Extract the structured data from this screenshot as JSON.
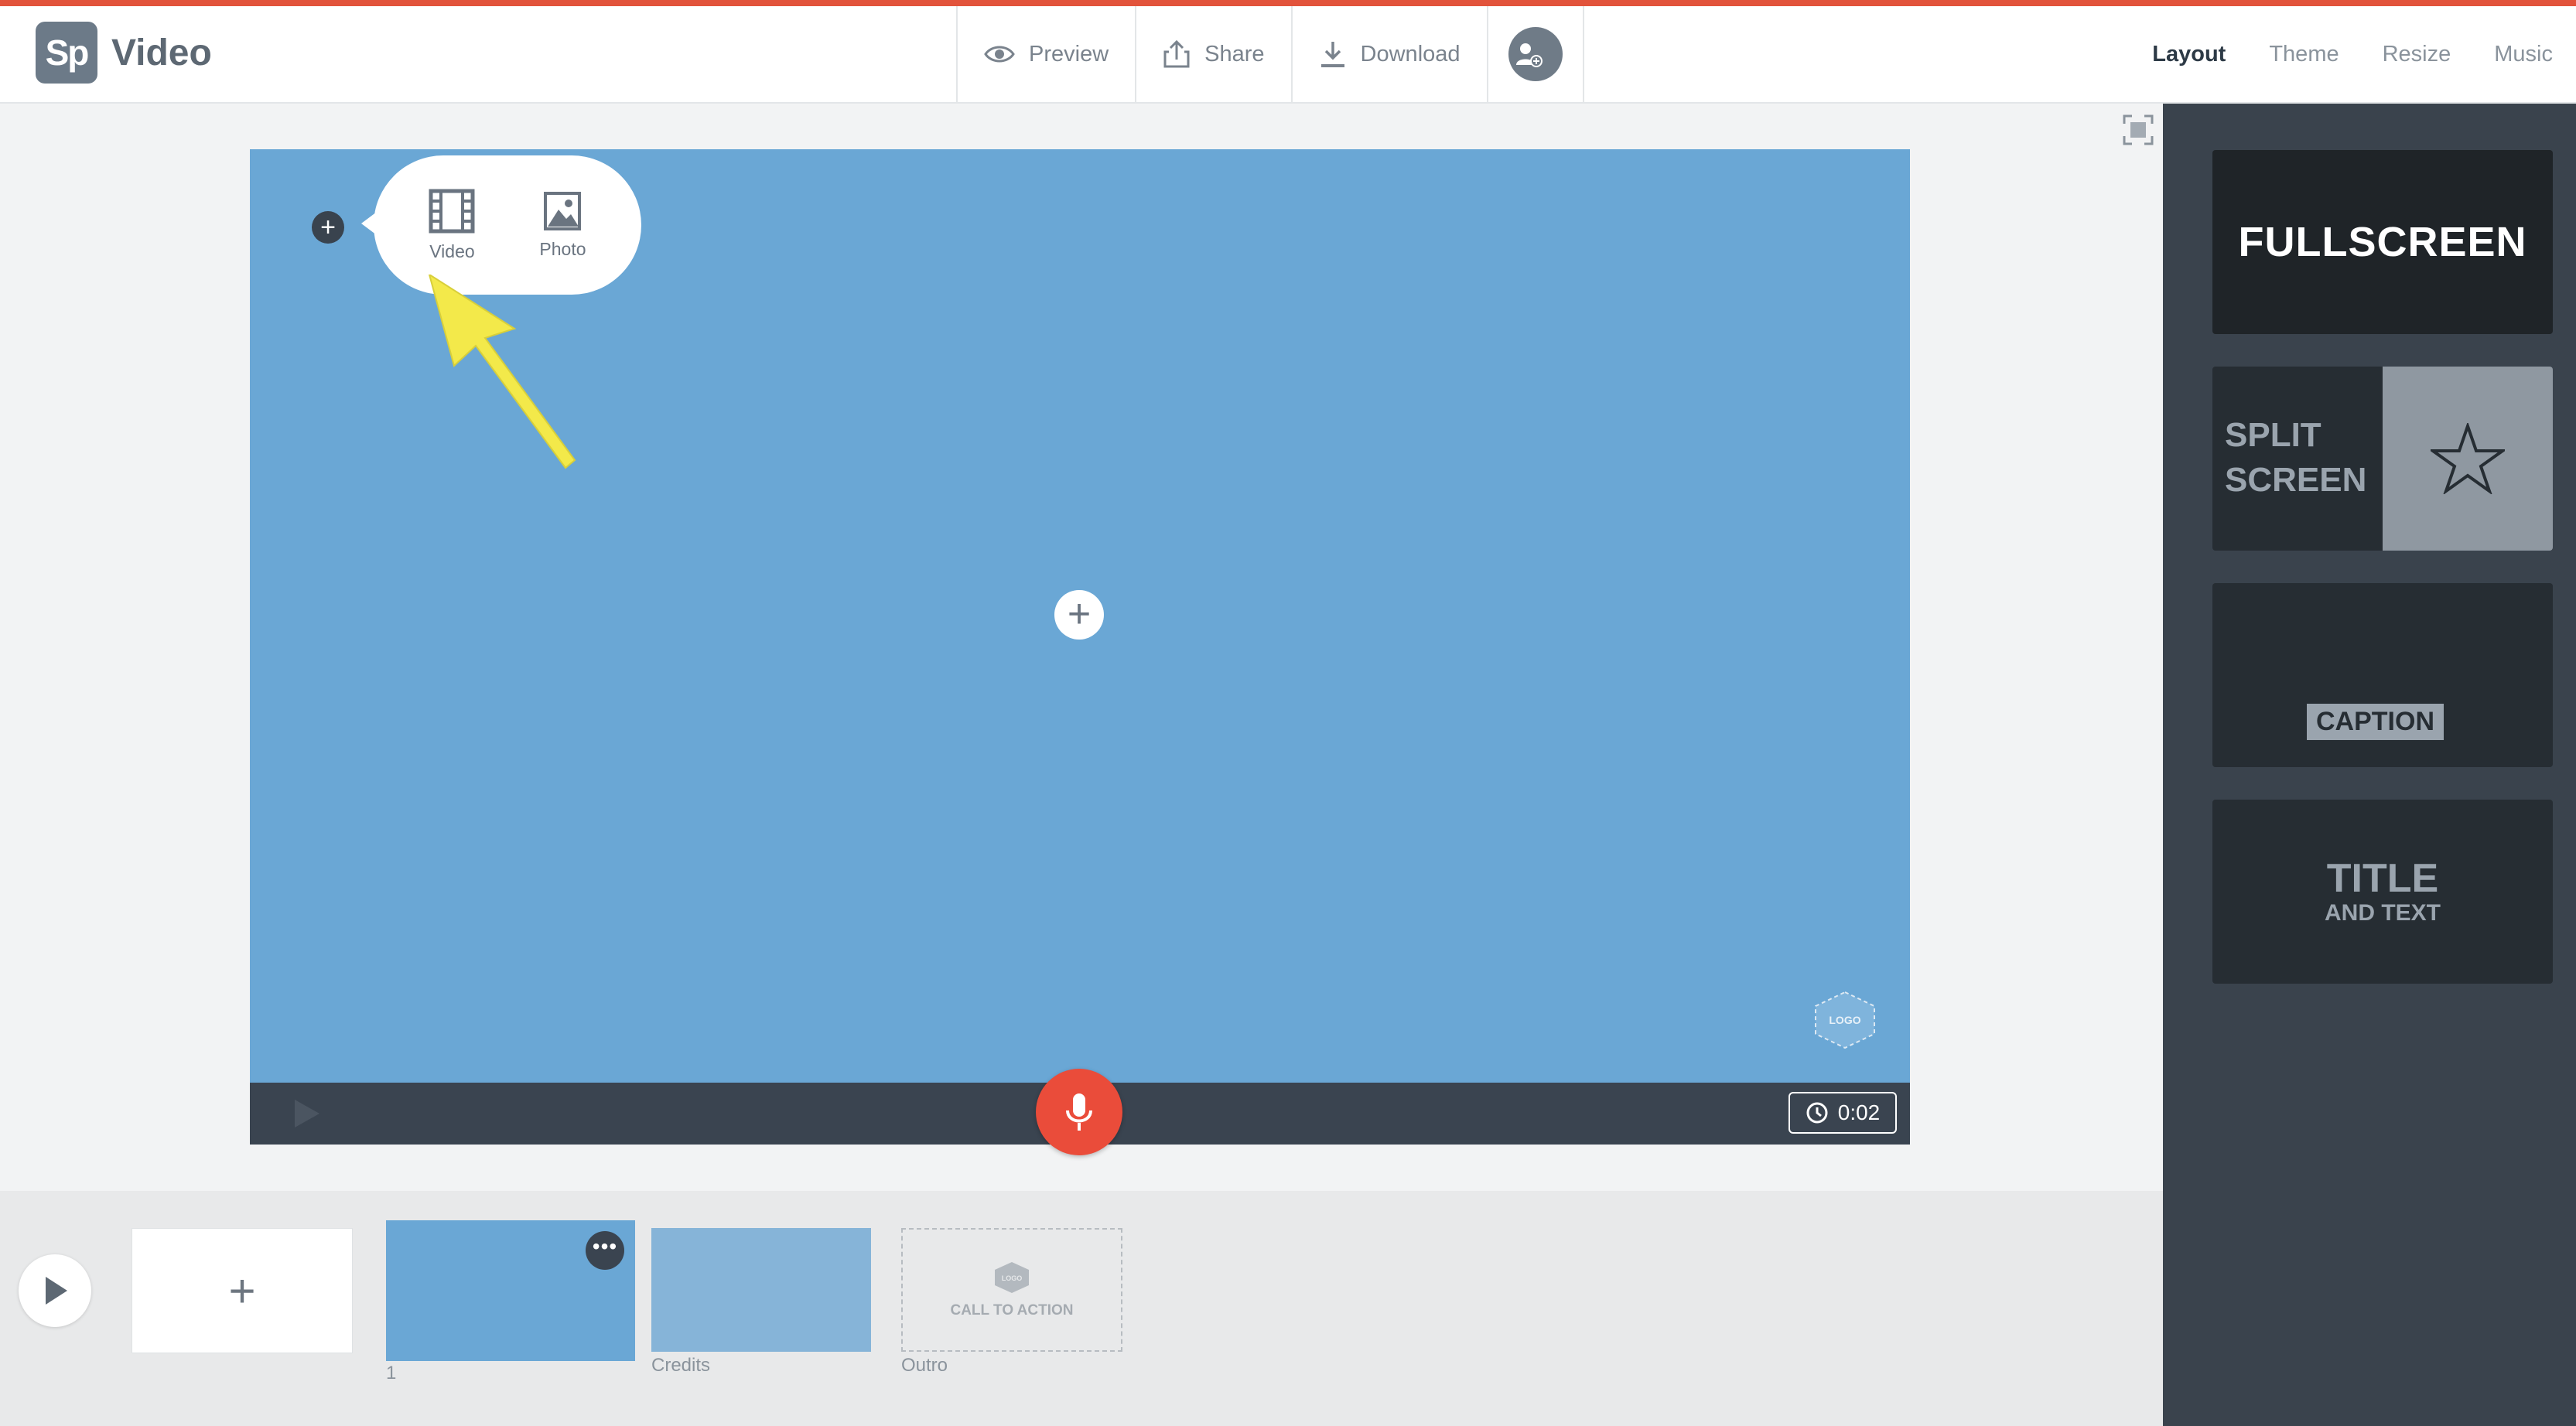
{
  "app": {
    "logo": "Sp",
    "name": "Video"
  },
  "toolbar": {
    "preview": "Preview",
    "share": "Share",
    "download": "Download"
  },
  "right_tabs": [
    "Layout",
    "Theme",
    "Resize",
    "Music"
  ],
  "right_tabs_active": "Layout",
  "canvas": {
    "popup": {
      "video": "Video",
      "photo": "Photo"
    },
    "logo_mark": "LOGO",
    "timer": "0:02"
  },
  "timeline": {
    "slides": [
      {
        "label": "1"
      },
      {
        "label": "Credits"
      },
      {
        "label": "Outro"
      }
    ],
    "add_label": "+",
    "outro_logo": "LOGO",
    "outro_cta": "CALL TO ACTION"
  },
  "layouts": {
    "fullscreen": "FULLSCREEN",
    "split_line1": "SPLIT",
    "split_line2": "SCREEN",
    "caption": "CAPTION",
    "title_line1": "TITLE",
    "title_line2": "AND TEXT"
  },
  "colors": {
    "accent": "#e2533b",
    "canvas_blue": "#6aa7d5",
    "mic_red": "#ea4c3a",
    "panel_dark": "#3a434d",
    "annotation_yellow": "#f3e94a"
  },
  "icons": [
    "eye-icon",
    "share-icon",
    "download-icon",
    "add-user-icon",
    "film-icon",
    "image-icon",
    "plus-icon",
    "microphone-icon",
    "clock-icon",
    "play-icon",
    "more-icon",
    "fullscreen-icon",
    "star-icon"
  ]
}
